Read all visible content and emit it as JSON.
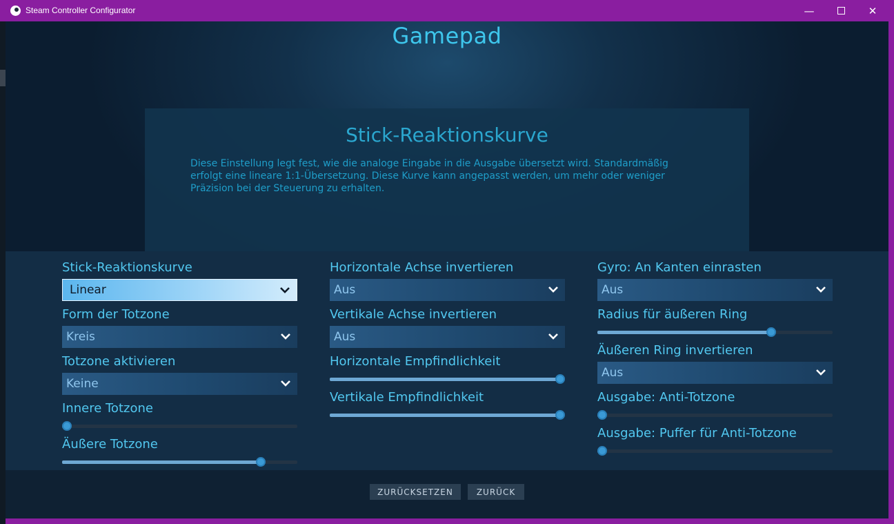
{
  "window": {
    "title": "Steam Controller Configurator",
    "icon": "steam-icon",
    "minimize_glyph": "—",
    "close_glyph": "✕"
  },
  "page": {
    "title": "Gamepad"
  },
  "info": {
    "title": "Stick-Reaktionskurve",
    "description": "Diese Einstellung legt fest, wie die analoge Eingabe in die Ausgabe übersetzt wird. Standardmäßig erfolgt eine lineare 1:1-Übersetzung. Diese Kurve kann angepasst werden, um mehr oder weniger Präzision bei der Steuerung zu erhalten."
  },
  "settings": {
    "col1": {
      "response_curve": {
        "label": "Stick-Reaktionskurve",
        "value": "Linear"
      },
      "deadzone_shape": {
        "label": "Form der Totzone",
        "value": "Kreis"
      },
      "deadzone_enable": {
        "label": "Totzone aktivieren",
        "value": "Keine"
      },
      "inner_deadzone": {
        "label": "Innere Totzone",
        "level": 0.0
      },
      "outer_deadzone": {
        "label": "Äußere Totzone",
        "level": 0.86
      }
    },
    "col2": {
      "invert_horizontal": {
        "label": "Horizontale Achse invertieren",
        "value": "Aus"
      },
      "invert_vertical": {
        "label": "Vertikale Achse invertieren",
        "value": "Aus"
      },
      "sensitivity_horizontal": {
        "label": "Horizontale Empfindlichkeit",
        "level": 1.0
      },
      "sensitivity_vertical": {
        "label": "Vertikale Empfindlichkeit",
        "level": 1.0
      }
    },
    "col3": {
      "gyro_snap": {
        "label": "Gyro: An Kanten einrasten",
        "value": "Aus"
      },
      "outer_ring_radius": {
        "label": "Radius für äußeren Ring",
        "level": 0.75
      },
      "invert_outer_ring": {
        "label": "Äußeren Ring invertieren",
        "value": "Aus"
      },
      "anti_deadzone": {
        "label": "Ausgabe: Anti-Totzone",
        "level": 0.0
      },
      "anti_deadzone_buffer": {
        "label": "Ausgabe: Puffer für Anti-Totzone",
        "level": 0.0
      }
    }
  },
  "footer": {
    "reset_label": "ZURÜCKSETZEN",
    "back_label": "ZURÜCK"
  },
  "colors": {
    "titlebar": "#8a1ea0",
    "accent": "#3ec6ec",
    "label": "#52c8f0",
    "slider_fill": "#6ea8d4"
  }
}
